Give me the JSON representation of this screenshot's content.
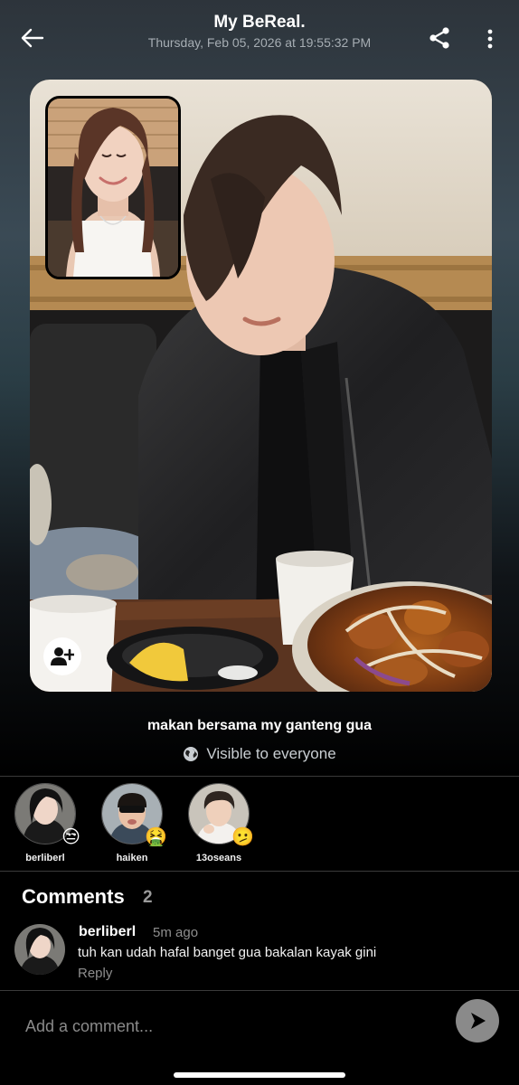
{
  "header": {
    "title": "My BeReal.",
    "timestamp": "Thursday, Feb 05, 2026 at 19:55:32 PM",
    "back_icon": "arrow-left-icon",
    "share_icon": "share-icon",
    "more_icon": "more-vertical-icon"
  },
  "post": {
    "caption": "makan bersama my ganteng gua",
    "visibility_icon": "globe-icon",
    "visibility": "Visible to everyone",
    "add_friend_icon": "add-person-icon"
  },
  "realmojis": [
    {
      "username": "berliberl",
      "emoji": "😒"
    },
    {
      "username": "haiken",
      "emoji": "🤮"
    },
    {
      "username": "13oseans",
      "emoji": "🫤"
    }
  ],
  "comments_section": {
    "title": "Comments",
    "count": "2",
    "items": [
      {
        "username": "berliberl",
        "time": "5m ago",
        "text": "tuh kan udah hafal banget gua bakalan kayak gini",
        "reply_label": "Reply"
      }
    ]
  },
  "composer": {
    "placeholder": "Add a comment...",
    "send_icon": "send-arrow-icon"
  },
  "colors": {
    "background": "#000000",
    "muted_text": "#8e8e8e",
    "send_button": "#8a8a8a"
  }
}
